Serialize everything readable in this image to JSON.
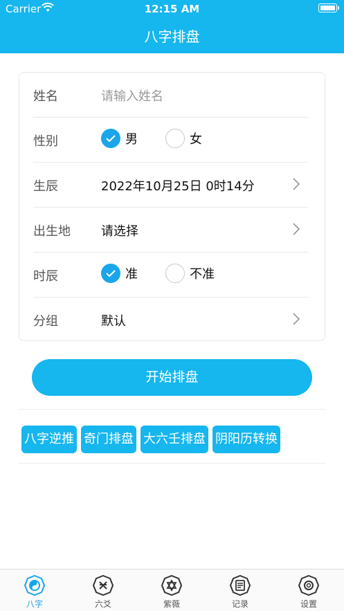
{
  "status_bar": {
    "carrier": "Carrier",
    "time": "12:15 AM"
  },
  "nav": {
    "title": "八字排盘"
  },
  "form": {
    "name": {
      "label": "姓名",
      "placeholder": "请输入姓名"
    },
    "gender": {
      "label": "性别",
      "options": [
        "男",
        "女"
      ],
      "selected": "男"
    },
    "birth_time": {
      "label": "生辰",
      "value": "2022年10月25日 0时14分"
    },
    "birth_place": {
      "label": "出生地",
      "value": "请选择"
    },
    "hour": {
      "label": "时辰",
      "options": [
        "准",
        "不准"
      ],
      "selected": "准"
    },
    "group": {
      "label": "分组",
      "value": "默认"
    }
  },
  "start_button": "开始排盘",
  "tools": [
    "八字逆推",
    "奇门排盘",
    "大六壬排盘",
    "阴阳历转换"
  ],
  "tabbar": {
    "items": [
      {
        "label": "八字",
        "icon": "bagua-icon",
        "active": true
      },
      {
        "label": "六爻",
        "icon": "liuyao-icon",
        "active": false
      },
      {
        "label": "紫薇",
        "icon": "star-icon",
        "active": false
      },
      {
        "label": "记录",
        "icon": "record-icon",
        "active": false
      },
      {
        "label": "设置",
        "icon": "gear-icon",
        "active": false
      }
    ]
  },
  "colors": {
    "accent": "#16b6ee",
    "radio_on": "#1aa6ea"
  }
}
